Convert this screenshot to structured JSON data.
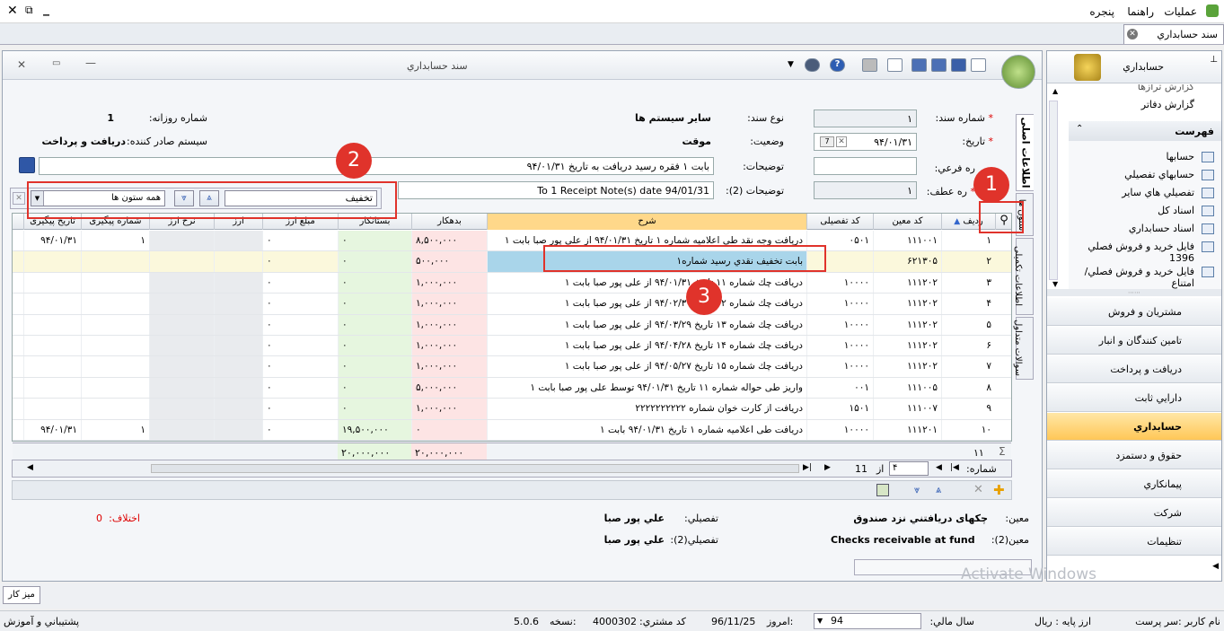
{
  "menubar": {
    "items": [
      "عملیات",
      "راهنما",
      "پنجره"
    ]
  },
  "tab": {
    "label": "سند حسابداري"
  },
  "window": {
    "title": "سند حسابداري"
  },
  "vtabs": [
    "اطلاعات اصلی",
    "ستون ها",
    "اطلاعات تکمیلی",
    "سوالات متداول"
  ],
  "form": {
    "doc_number_label": "شماره سند:",
    "doc_number": "۱",
    "doc_type_label": "نوع سند:",
    "doc_type": "ساير سيستم ها",
    "daily_number_label": "شماره روزانه:",
    "daily_number": "1",
    "date_label": "تاريخ:",
    "date": "۹۴/۰۱/۳۱",
    "status_label": "وضعيت:",
    "status": "موقت",
    "issuer_label": "سيستم صادر کننده:",
    "issuer": "دريافت و پرداخت",
    "sub_number_label": "ره فرعي:",
    "desc_label": "توضيحات:",
    "desc": "بابت ۱ فقره رسید دریافت به تاریخ ۹۴/۰۱/۳۱",
    "ref_number_label": "ره عطف:",
    "ref_number": "۱",
    "desc2_label": "توضيحات (2):",
    "desc2": "To 1 Receipt Note(s) date 94/01/31"
  },
  "search": {
    "value": "تخفیف",
    "scope": "همه ستون ها"
  },
  "grid": {
    "headers": [
      "ردیف",
      "کد معین",
      "کد تفصیلی",
      "شرح",
      "بدهکار",
      "بستانکار",
      "مبلغ ارز",
      "ارز",
      "نرخ ارز",
      "شماره پیگیری",
      "تاریخ پیگیری"
    ],
    "rows": [
      [
        "۱",
        "۱۱۱۰۰۱",
        "۰۵۰۱",
        "دریافت وجه نقد طی اعلامیه شماره ۱ تاریخ ۹۴/۰۱/۳۱ از علی پور صبا بابت ۱",
        "۸,۵۰۰,۰۰۰",
        "۰",
        "۰",
        "",
        "",
        "۱",
        "۹۴/۰۱/۳۱"
      ],
      [
        "۲",
        "۶۲۱۳۰۵",
        "",
        "بابت تخفیف نقدي رسيد شماره۱",
        "۵۰۰,۰۰۰",
        "۰",
        "۰",
        "",
        "",
        "",
        ""
      ],
      [
        "۳",
        "۱۱۱۲۰۲",
        "۱۰۰۰۰",
        "دریافت چك شماره ۱۱ تاریخ ۹۴/۰۱/۳۱ از علی پور صبا بابت ۱",
        "۱,۰۰۰,۰۰۰",
        "۰",
        "۰",
        "",
        "",
        "",
        ""
      ],
      [
        "۴",
        "۱۱۱۲۰۲",
        "۱۰۰۰۰",
        "دریافت چك شماره ۱۲ تاریخ ۹۴/۰۲/۳۰ از علی پور صبا بابت ۱",
        "۱,۰۰۰,۰۰۰",
        "۰",
        "۰",
        "",
        "",
        "",
        ""
      ],
      [
        "۵",
        "۱۱۱۲۰۲",
        "۱۰۰۰۰",
        "دریافت چك شماره ۱۳ تاریخ ۹۴/۰۳/۲۹ از علی پور صبا بابت ۱",
        "۱,۰۰۰,۰۰۰",
        "۰",
        "۰",
        "",
        "",
        "",
        ""
      ],
      [
        "۶",
        "۱۱۱۲۰۲",
        "۱۰۰۰۰",
        "دریافت چك شماره ۱۴ تاریخ ۹۴/۰۴/۲۸ از علی پور صبا بابت ۱",
        "۱,۰۰۰,۰۰۰",
        "۰",
        "۰",
        "",
        "",
        "",
        ""
      ],
      [
        "۷",
        "۱۱۱۲۰۲",
        "۱۰۰۰۰",
        "دریافت چك شماره ۱۵ تاریخ ۹۴/۰۵/۲۷ از علی پور صبا بابت ۱",
        "۱,۰۰۰,۰۰۰",
        "۰",
        "۰",
        "",
        "",
        "",
        ""
      ],
      [
        "۸",
        "۱۱۱۰۰۵",
        "۰۰۱",
        "واریز طی حواله شماره ۱۱ تاریخ ۹۴/۰۱/۳۱ توسط علی پور صبا بابت ۱",
        "۵,۰۰۰,۰۰۰",
        "۰",
        "۰",
        "",
        "",
        "",
        ""
      ],
      [
        "۹",
        "۱۱۱۰۰۷",
        "۱۵۰۱",
        "دریافت از کارت خوان شماره ۲۲۲۲۲۲۲۲۲۲",
        "۱,۰۰۰,۰۰۰",
        "۰",
        "۰",
        "",
        "",
        "",
        ""
      ],
      [
        "۱۰",
        "۱۱۱۲۰۱",
        "۱۰۰۰۰",
        "دریافت طی اعلامیه شماره ۱ تاریخ ۹۴/۰۱/۳۱ بابت ۱",
        "۰",
        "۱۹,۵۰۰,۰۰۰",
        "۰",
        "",
        "",
        "۱",
        "۹۴/۰۱/۳۱"
      ]
    ],
    "footer": {
      "count": "۱۱",
      "debit_total": "۲۰,۰۰۰,۰۰۰",
      "credit_total": "۲۰,۰۰۰,۰۰۰"
    },
    "pager": {
      "label": ":شماره",
      "current": "۴",
      "of": "از",
      "total": "11"
    }
  },
  "bottom": {
    "moein_label": "معين:",
    "moein_value": "چکهای دریافتني نزد صندوق",
    "moein2_label": "معين(2):",
    "moein2_value": "Checks receivable at fund",
    "tafsili_label": "تفصيلي:",
    "tafsili_value": "علي پور صبا",
    "tafsili2_label": "تفصيلي(2):",
    "tafsili2_value": "علي پور صبا",
    "diff_label": "اختلاف:",
    "diff_value": "0"
  },
  "sidebar": {
    "header": "حسابداري",
    "tree_partial": "گزارش ترازها",
    "tree_top": "گزارش دفاتر",
    "list_title": "فهرست",
    "list": [
      "حسابها",
      "حسابهاي تفصيلي",
      "تفصيلي هاي ساير",
      "اسناد کل",
      "اسناد حسابداري",
      "فايل خريد و فروش فصلي 1396",
      "فايل خريد و فروش فصلي/امتناع"
    ],
    "modules": [
      "مشتريان و فروش",
      "تامین کنندگان و انبار",
      "دريافت و پرداخت",
      "دارايي ثابت",
      "حسابداري",
      "حقوق و دستمزد",
      "پيمانکاري",
      "شرکت",
      "تنظيمات"
    ]
  },
  "desk": {
    "label": "ميز کار"
  },
  "watermark": "Activate Windows",
  "statusbar": {
    "user": "نام کاربر :سر پرست",
    "base_currency": "ارز پايه : ريال",
    "fiscal_label": "سال مالي:",
    "fiscal": "94",
    "today_label": "امروز:",
    "today": "96/11/25",
    "customer_label": "کد مشتري:",
    "customer": "4000302",
    "version_label": "نسخه:",
    "version": "5.0.6",
    "support": "پشتيباني و آموزش"
  },
  "callouts": [
    "1",
    "2",
    "3"
  ],
  "colors": {
    "accent_red": "#e0332b",
    "debit_bg": "#fde4e4",
    "credit_bg": "#e6f6df",
    "highlight": "#a9d5ea",
    "selected_row": "#fbf8dc",
    "header_orange": "#ffd88a"
  }
}
